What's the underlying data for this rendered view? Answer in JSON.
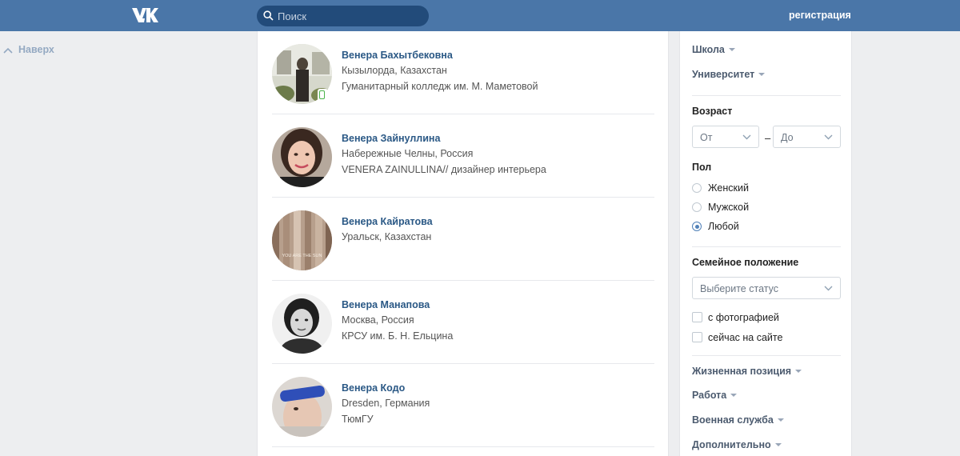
{
  "header": {
    "logo": "VK",
    "search_placeholder": "Поиск",
    "register_label": "регистрация"
  },
  "scroll_up_label": "Наверх",
  "results": [
    {
      "name": "Венера Бахытбековна",
      "line1": "Кызылорда, Казахстан",
      "line2": "Гуманитарный колледж им. М. Маметовой",
      "online_mobile": true,
      "avatar_colors": [
        "#dcdfd3",
        "#5e5a4c"
      ]
    },
    {
      "name": "Венера Зайнуллина",
      "line1": "Набережные Челны, Россия",
      "line2": "VENERA ZAINULLINA// дизайнер интерьера",
      "online_mobile": false,
      "avatar_colors": [
        "#b9a79a",
        "#3c2a24"
      ]
    },
    {
      "name": "Венера Кайратова",
      "line1": "Уральск, Казахстан",
      "line2": "",
      "online_mobile": false,
      "avatar_colors": [
        "#c7b5a4",
        "#6e5648"
      ],
      "avatar_text": "YOU ARE THE SUN"
    },
    {
      "name": "Венера Манапова",
      "line1": "Москва, Россия",
      "line2": "КРСУ им. Б. Н. Ельцина",
      "online_mobile": false,
      "avatar_colors": [
        "#e8e8e8",
        "#2d2d2d"
      ]
    },
    {
      "name": "Венера Кодо",
      "line1": "Dresden, Германия",
      "line2": "ТюмГУ",
      "online_mobile": false,
      "avatar_colors": [
        "#d9d4cf",
        "#2f4fb8"
      ]
    }
  ],
  "filters": {
    "school_label": "Школа",
    "university_label": "Университет",
    "age_title": "Возраст",
    "age_from": "От",
    "age_dash": "–",
    "age_to": "До",
    "gender_title": "Пол",
    "gender_options": [
      "Женский",
      "Мужской",
      "Любой"
    ],
    "gender_selected": "Любой",
    "marital_title": "Семейное положение",
    "marital_placeholder": "Выберите статус",
    "with_photo_label": "с фотографией",
    "online_now_label": "сейчас на сайте",
    "life_position_label": "Жизненная позиция",
    "work_label": "Работа",
    "military_label": "Военная служба",
    "additional_label": "Дополнительно"
  },
  "colors": {
    "header_bg": "#4a76a8",
    "link": "#2a5885",
    "page_bg": "#edeef0",
    "online": "#4bb34b"
  }
}
